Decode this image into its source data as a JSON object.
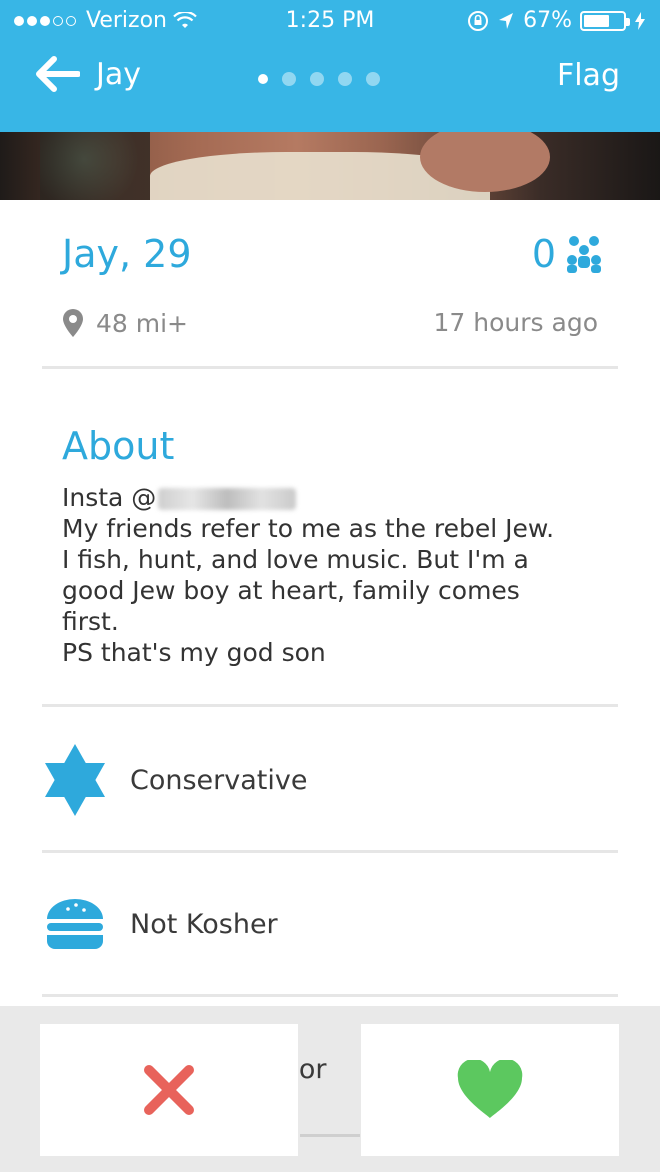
{
  "status_bar": {
    "carrier": "Verizon",
    "time": "1:25 PM",
    "battery": "67%",
    "battery_level": 0.67
  },
  "nav": {
    "back_label": "Jay",
    "flag_label": "Flag",
    "page_count": 5,
    "active_page": 1
  },
  "profile": {
    "name_age": "Jay, 29",
    "like_count": "0",
    "distance": "48 mi+",
    "last_active": "17 hours ago"
  },
  "about": {
    "title": "About",
    "lines": [
      "Insta @",
      "My friends refer to me as the rebel Jew.",
      "I fish, hunt, and love music. But I'm a",
      "good Jew boy at heart, family comes",
      "first.",
      "PS that's my god son"
    ]
  },
  "attributes": [
    {
      "label": "Conservative",
      "icon": "star-of-david-icon"
    },
    {
      "label": "Not Kosher",
      "icon": "burger-icon"
    }
  ],
  "actions": {
    "peek_text": "Cor",
    "pass_icon": "x-icon",
    "like_icon": "heart-icon"
  },
  "colors": {
    "accent": "#38b6e6",
    "pass": "#e8635b",
    "like": "#5cc85f"
  }
}
